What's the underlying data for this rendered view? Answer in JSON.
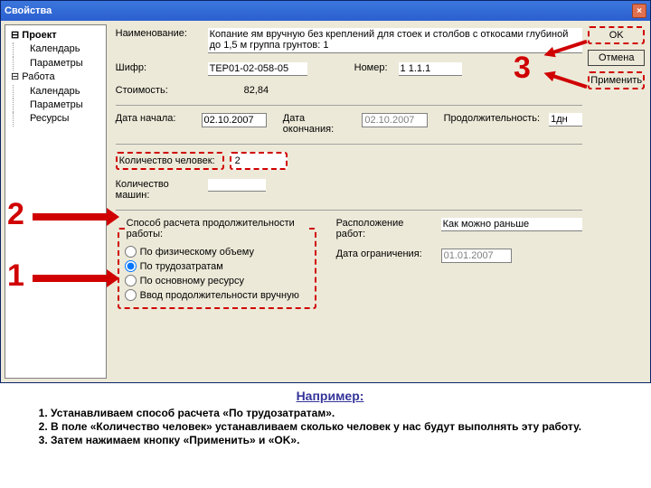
{
  "window": {
    "title": "Свойства"
  },
  "tree": {
    "project": "Проект",
    "project_children": [
      "Календарь",
      "Параметры"
    ],
    "work": "Работа",
    "work_children": [
      "Календарь",
      "Параметры",
      "Ресурсы"
    ]
  },
  "buttons": {
    "ok": "OK",
    "cancel": "Отмена",
    "apply": "Применить"
  },
  "labels": {
    "name": "Наименование:",
    "code": "Шифр:",
    "number": "Номер:",
    "cost": "Стоимость:",
    "dstart": "Дата начала:",
    "dend": "Дата окончания:",
    "duration": "Продолжительность:",
    "persons": "Количество человек:",
    "machines": "Количество машин:",
    "calc_group": "Способ расчета продолжительности работы:",
    "placement": "Расположение работ:",
    "dlimit": "Дата ограничения:"
  },
  "values": {
    "name": "Копание ям вручную без креплений для стоек и столбов с откосами глубиной до 1,5 м группа грунтов: 1",
    "code": "ТЕР01-02-058-05",
    "number": "1 1.1.1",
    "cost": "82,84",
    "dstart": "02.10.2007",
    "dend": "02.10.2007",
    "duration": "1дн",
    "persons": "2",
    "machines": "",
    "placement": "Как можно раньше",
    "dlimit": "01.01.2007"
  },
  "calc_options": [
    "По физическому объему",
    "По трудозатратам",
    "По основному ресурсу",
    "Ввод продолжительности вручную"
  ],
  "annotations": {
    "n1": "1",
    "n2": "2",
    "n3": "3"
  },
  "footer": {
    "heading": "Например:",
    "items": [
      "Устанавливаем способ расчета «По трудозатратам».",
      "В поле «Количество человек» устанавливаем сколько человек у нас будут выполнять эту работу.",
      "Затем нажимаем кнопку «Применить» и  «OK»."
    ]
  }
}
